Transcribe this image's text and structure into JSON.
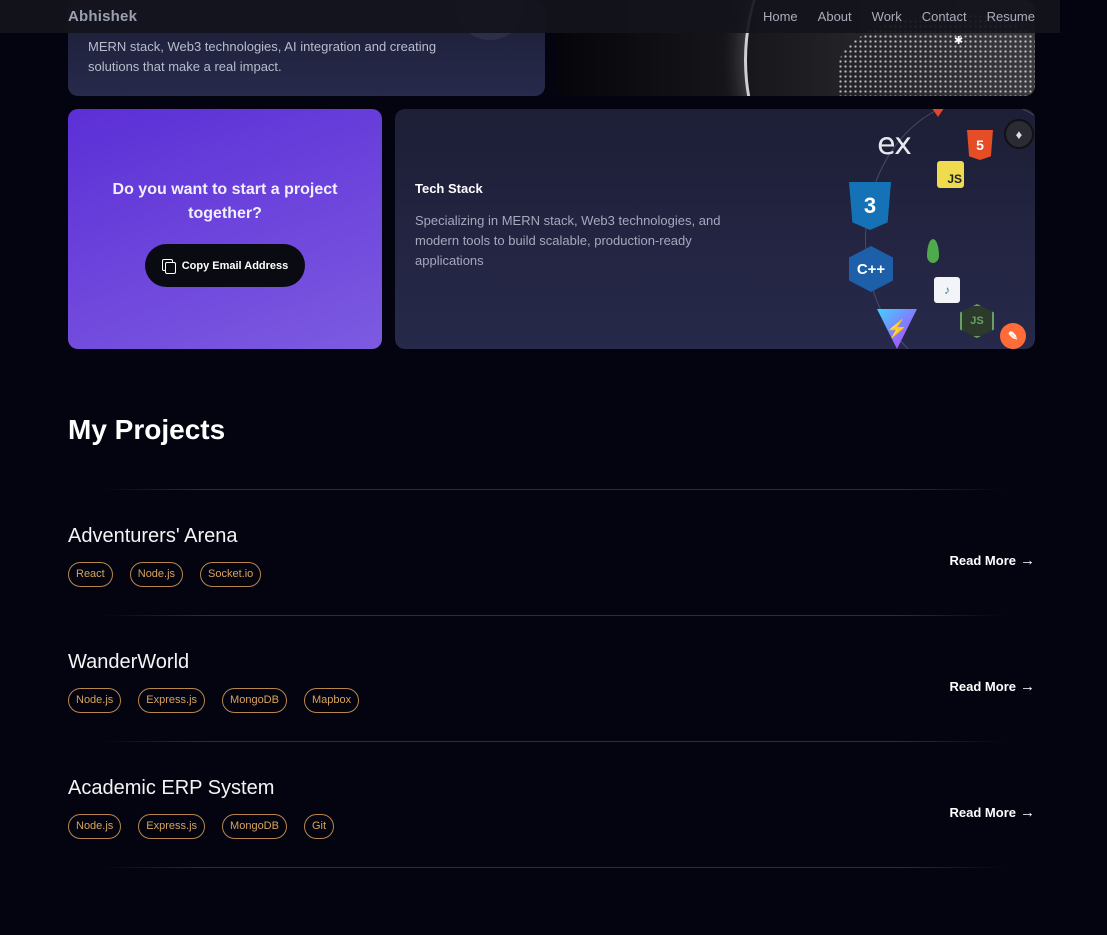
{
  "navbar": {
    "brand": "Abhishek",
    "links": [
      "Home",
      "About",
      "Work",
      "Contact",
      "Resume"
    ]
  },
  "intro_card": {
    "text": "MERN stack, Web3 technologies, AI integration and creating solutions that make a real impact."
  },
  "cta_card": {
    "heading": "Do you want to start a project together?",
    "button_label": "Copy Email Address"
  },
  "tech_card": {
    "title": "Tech Stack",
    "description": "Specializing in MERN stack, Web3 technologies, and modern tools to build scalable, production-ready applications",
    "icons": [
      "express-icon",
      "html5-icon",
      "github-icon",
      "javascript-icon",
      "css3-icon",
      "microsoft-icon",
      "mongodb-icon",
      "cplusplus-icon",
      "mysql-icon",
      "nodejs-icon",
      "vite-icon",
      "postman-icon"
    ],
    "icon_glyphs": {
      "express": "ex",
      "html": "5",
      "js": "JS",
      "css": "3",
      "cpp": "C++",
      "node": "JS",
      "vite": "⚡",
      "postman": "✎",
      "mysql": "✨",
      "github": "•"
    }
  },
  "projects_section": {
    "title": "My Projects",
    "read_more_label": "Read More",
    "projects": [
      {
        "title": "Adventurers' Arena",
        "tags": [
          "React",
          "Node.js",
          "Socket.io"
        ]
      },
      {
        "title": "WanderWorld",
        "tags": [
          "Node.js",
          "Express.js",
          "MongoDB",
          "Mapbox"
        ]
      },
      {
        "title": "Academic ERP System",
        "tags": [
          "Node.js",
          "Express.js",
          "MongoDB",
          "Git"
        ]
      }
    ]
  },
  "colors": {
    "background": "#03040f",
    "accent_purple": "#5b2fd6",
    "tag_border": "#b8864a",
    "tag_text": "#d8a45c"
  }
}
